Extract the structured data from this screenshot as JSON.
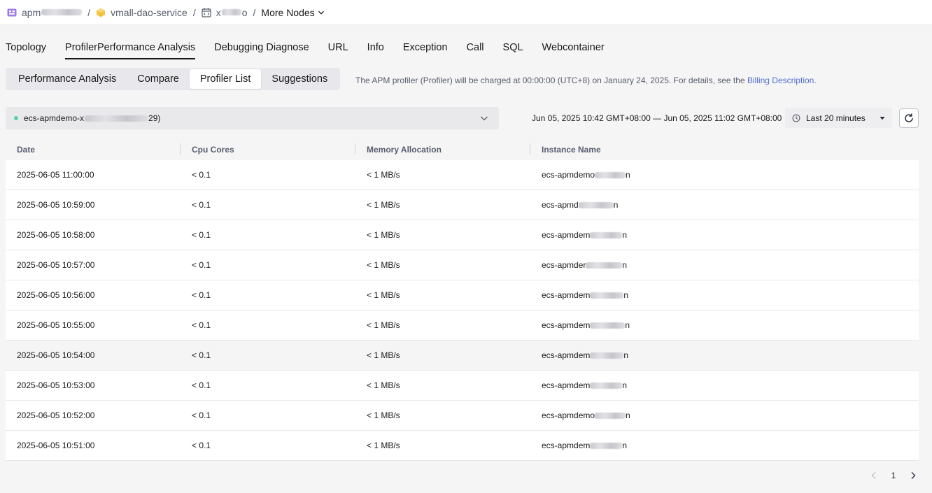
{
  "breadcrumb": {
    "app_prefix": "apm",
    "service": "vmall-dao-service",
    "node_prefix": "x",
    "node_suffix": "o",
    "more_nodes": "More Nodes",
    "separator": "/"
  },
  "tabs": [
    {
      "label": "Topology",
      "active": false
    },
    {
      "label": "ProfilerPerformance Analysis",
      "active": true
    },
    {
      "label": "Debugging Diagnose",
      "active": false
    },
    {
      "label": "URL",
      "active": false
    },
    {
      "label": "Info",
      "active": false
    },
    {
      "label": "Exception",
      "active": false
    },
    {
      "label": "Call",
      "active": false
    },
    {
      "label": "SQL",
      "active": false
    },
    {
      "label": "Webcontainer",
      "active": false
    }
  ],
  "subtabs": [
    {
      "label": "Performance Analysis",
      "active": false
    },
    {
      "label": "Compare",
      "active": false
    },
    {
      "label": "Profiler List",
      "active": true
    },
    {
      "label": "Suggestions",
      "active": false
    }
  ],
  "notice": {
    "text": "The APM profiler (Profiler) will be charged at 00:00:00 (UTC+8) on January 24, 2025. For details, see the ",
    "link": "Billing Description",
    "end": "."
  },
  "instance": {
    "prefix": "ecs-apmdemo-x",
    "suffix": "29)",
    "status_color": "#5ad1a8"
  },
  "time": {
    "range": "Jun 05, 2025 10:42 GMT+08:00 — Jun 05, 2025 11:02 GMT+08:00",
    "preset": "Last 20 minutes"
  },
  "table": {
    "columns": [
      "Date",
      "Cpu Cores",
      "Memory Allocation",
      "Instance Name"
    ],
    "rows": [
      {
        "date": "2025-06-05 11:00:00",
        "cpu": "< 0.1",
        "mem": "< 1 MB/s",
        "instance": "ecs-apmdemo",
        "instance_tail": "n"
      },
      {
        "date": "2025-06-05 10:59:00",
        "cpu": "< 0.1",
        "mem": "< 1 MB/s",
        "instance": "ecs-apmd",
        "instance_tail": "n"
      },
      {
        "date": "2025-06-05 10:58:00",
        "cpu": "< 0.1",
        "mem": "< 1 MB/s",
        "instance": "ecs-apmdem",
        "instance_tail": "n"
      },
      {
        "date": "2025-06-05 10:57:00",
        "cpu": "< 0.1",
        "mem": "< 1 MB/s",
        "instance": "ecs-apmder",
        "instance_tail": "n"
      },
      {
        "date": "2025-06-05 10:56:00",
        "cpu": "< 0.1",
        "mem": "< 1 MB/s",
        "instance": "ecs-apmdem",
        "instance_tail": "n"
      },
      {
        "date": "2025-06-05 10:55:00",
        "cpu": "< 0.1",
        "mem": "< 1 MB/s",
        "instance": "ecs-apmdem",
        "instance_tail": "n"
      },
      {
        "date": "2025-06-05 10:54:00",
        "cpu": "< 0.1",
        "mem": "< 1 MB/s",
        "instance": "ecs-apmdem",
        "instance_tail": "n"
      },
      {
        "date": "2025-06-05 10:53:00",
        "cpu": "< 0.1",
        "mem": "< 1 MB/s",
        "instance": "ecs-apmdem",
        "instance_tail": "n"
      },
      {
        "date": "2025-06-05 10:52:00",
        "cpu": "< 0.1",
        "mem": "< 1 MB/s",
        "instance": "ecs-apmdemo",
        "instance_tail": "n"
      },
      {
        "date": "2025-06-05 10:51:00",
        "cpu": "< 0.1",
        "mem": "< 1 MB/s",
        "instance": "ecs-apmdem",
        "instance_tail": "n"
      }
    ]
  },
  "pagination": {
    "current": "1"
  },
  "icons": {
    "app": "app-grid-icon",
    "service": "cube-icon",
    "node": "calendar-node-icon",
    "chevron": "chevron-down-icon",
    "clock": "clock-icon",
    "caret": "caret-down-icon",
    "refresh": "refresh-icon",
    "prev": "chevron-left-icon",
    "next": "chevron-right-icon"
  }
}
